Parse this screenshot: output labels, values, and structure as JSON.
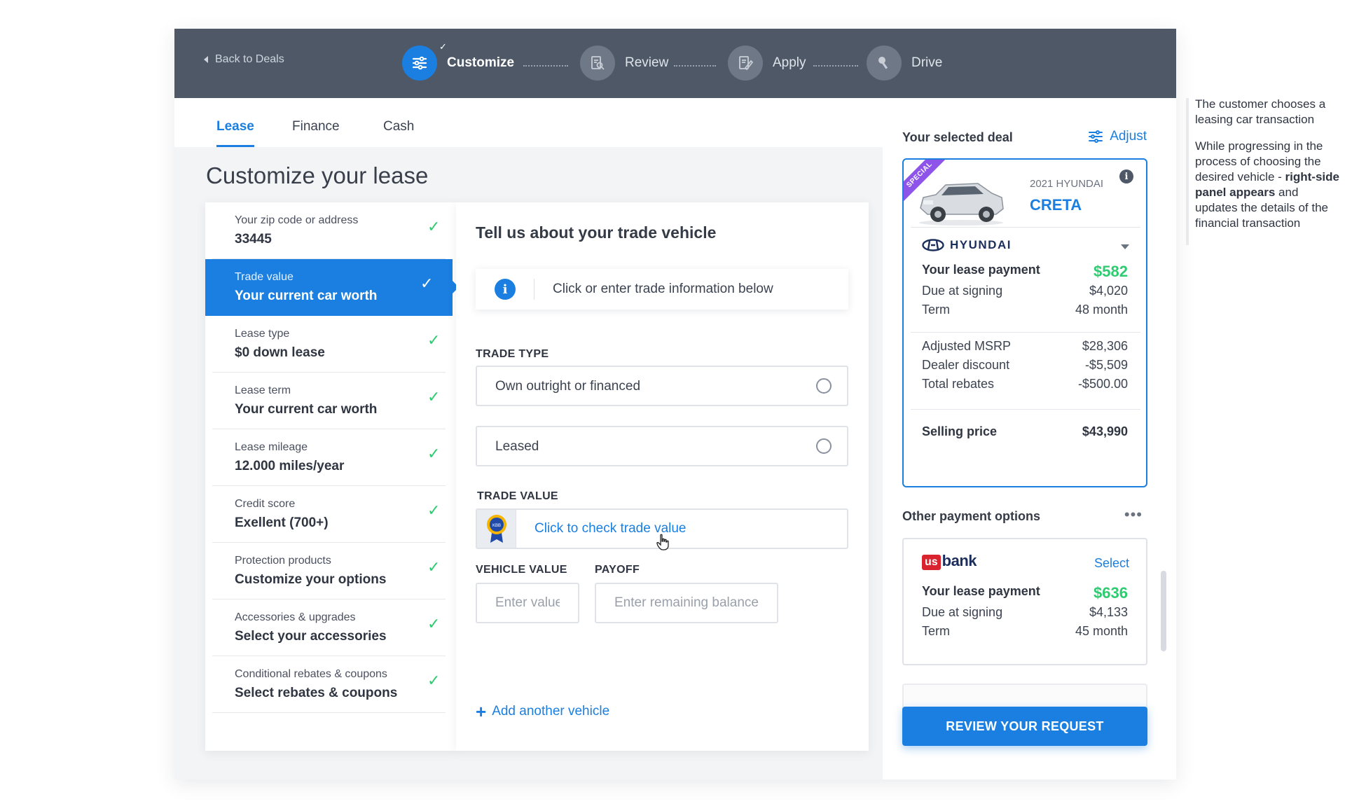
{
  "nav": {
    "back_label": "Back to Deals",
    "steps": [
      {
        "label": "Customize",
        "state": "active",
        "icon": "sliders-icon"
      },
      {
        "label": "Review",
        "state": "inactive",
        "icon": "document-search-icon"
      },
      {
        "label": "Apply",
        "state": "inactive",
        "icon": "sign-document-icon"
      },
      {
        "label": "Drive",
        "state": "inactive",
        "icon": "key-icon"
      }
    ],
    "completed_mark": "✓"
  },
  "tabs": [
    {
      "label": "Lease",
      "active": true
    },
    {
      "label": "Finance",
      "active": false
    },
    {
      "label": "Cash",
      "active": false
    }
  ],
  "page_title": "Customize your lease",
  "steps": [
    {
      "label": "Your zip code or address",
      "value": "33445",
      "done": true
    },
    {
      "label": "Trade value",
      "value": "Your current car worth",
      "done": true,
      "selected": true
    },
    {
      "label": "Lease type",
      "value": "$0 down lease",
      "done": true
    },
    {
      "label": "Lease term",
      "value": "Your current car worth",
      "done": true
    },
    {
      "label": "Lease mileage",
      "value": "12.000 miles/year",
      "done": true
    },
    {
      "label": "Credit score",
      "value": "Exellent (700+)",
      "done": true
    },
    {
      "label": "Protection products",
      "value": "Customize your options",
      "done": true
    },
    {
      "label": "Accessories & upgrades",
      "value": "Select your accessories",
      "done": true
    },
    {
      "label": "Conditional rebates & coupons",
      "value": "Select rebates & coupons",
      "done": true
    }
  ],
  "check_mark": "✓",
  "form": {
    "heading": "Tell us about your trade vehicle",
    "info_icon": "i",
    "info_text": "Click or enter trade information below",
    "trade_type_label": "TRADE TYPE",
    "trade_options": [
      "Own outright or financed",
      "Leased"
    ],
    "trade_value_label": "TRADE  VALUE",
    "trade_value_link": "Click to check trade value",
    "vehicle_value_label": "VEHICLE VALUE",
    "vehicle_value_placeholder": "Enter value",
    "payoff_label": "PAYOFF",
    "payoff_placeholder": "Enter remaining balance",
    "add_vehicle_icon": "+",
    "add_vehicle_label": "Add another vehicle"
  },
  "deal": {
    "title": "Your selected deal",
    "adjust_label": "Adjust",
    "ribbon": "SPECIAL",
    "year_make": "2021 HYUNDAI",
    "model": "CRETA",
    "info_icon": "i",
    "brand": "HYUNDAI",
    "payment_label": "Your lease payment",
    "payment": "$582",
    "due_label": "Due at signing",
    "due": "$4,020",
    "term_label": "Term",
    "term": "48 month",
    "msrp_label": "Adjusted MSRP",
    "msrp": "$28,306",
    "discount_label": "Dealer discount",
    "discount": "-$5,509",
    "rebates_label": "Total rebates",
    "rebates": "-$500.00",
    "selling_label": "Selling price",
    "selling": "$43,990"
  },
  "other": {
    "title": "Other payment options",
    "more_icon": "•••",
    "bank_prefix": "us",
    "bank_name": "bank",
    "select_label": "Select",
    "payment_label": "Your lease payment",
    "payment": "$636",
    "due_label": "Due at signing",
    "due": "$4,133",
    "term_label": "Term",
    "term": "45 month"
  },
  "review_button": "REVIEW YOUR REQUEST",
  "annotations": {
    "note1": "The customer chooses a leasing car transaction",
    "note2_a": "While progressing in the process of choosing the desired vehicle - ",
    "note2_b": "right-side panel appears",
    "note2_c": " and updates the details of the financial transaction"
  },
  "colors": {
    "accent": "#1a7fe0",
    "header": "#4e5867",
    "success": "#2ecc71",
    "ribbon": "#8e54e9"
  }
}
